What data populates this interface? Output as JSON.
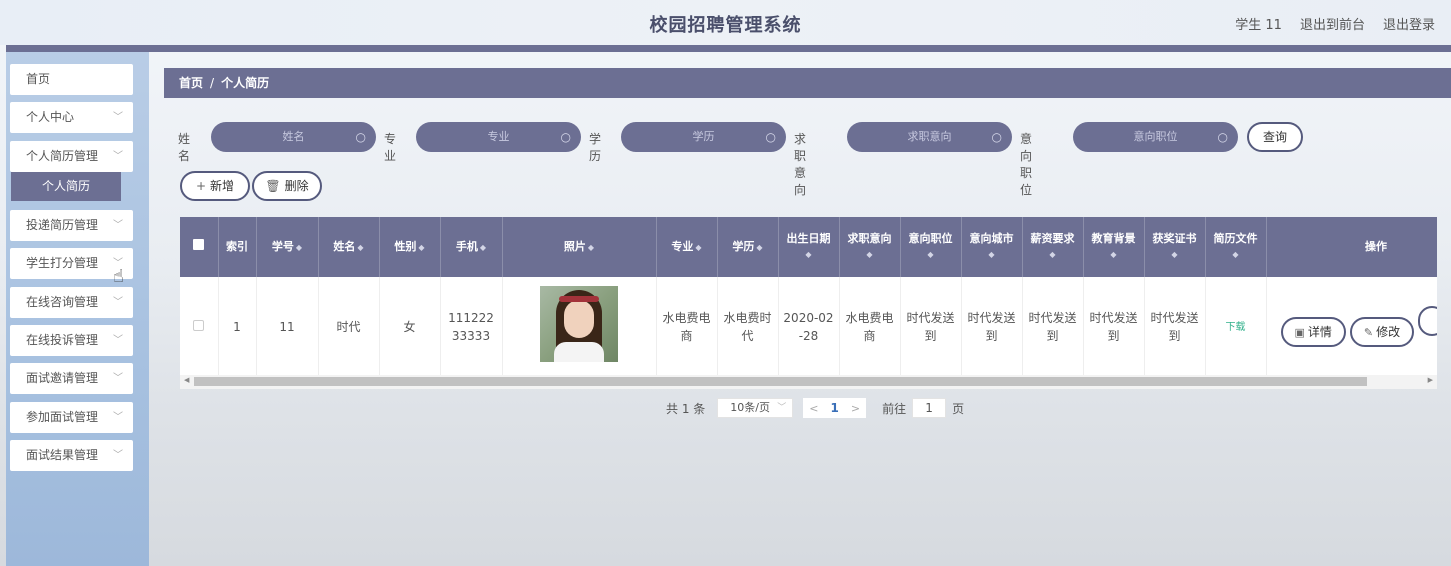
{
  "header": {
    "title": "校园招聘管理系统",
    "user": "学生 11",
    "back_to_front": "退出到前台",
    "logout": "退出登录"
  },
  "sidebar": {
    "items": [
      {
        "label": "首页"
      },
      {
        "label": "个人中心"
      },
      {
        "label": "个人简历管理"
      },
      {
        "label": "个人简历"
      },
      {
        "label": "投递简历管理"
      },
      {
        "label": "学生打分管理"
      },
      {
        "label": "在线咨询管理"
      },
      {
        "label": "在线投诉管理"
      },
      {
        "label": "面试邀请管理"
      },
      {
        "label": "参加面试管理"
      },
      {
        "label": "面试结果管理"
      }
    ]
  },
  "breadcrumb": {
    "home": "首页",
    "sep": "/",
    "current": "个人简历"
  },
  "search": {
    "fields": [
      {
        "label": "姓名",
        "placeholder": "姓名"
      },
      {
        "label": "专业",
        "placeholder": "专业"
      },
      {
        "label": "学历",
        "placeholder": "学历"
      },
      {
        "label": "求职意向",
        "placeholder": "求职意向"
      },
      {
        "label": "意向职位",
        "placeholder": "意向职位"
      }
    ],
    "query_button": "查询"
  },
  "actions": {
    "add": "新增",
    "delete": "删除"
  },
  "table": {
    "headers": [
      "索引",
      "学号",
      "姓名",
      "性别",
      "手机",
      "照片",
      "专业",
      "学历",
      "出生日期",
      "求职意向",
      "意向职位",
      "意向城市",
      "薪资要求",
      "教育背景",
      "获奖证书",
      "简历文件",
      "操作"
    ],
    "rows": [
      {
        "index": "1",
        "student_no": "11",
        "name": "时代",
        "gender": "女",
        "phone": "11122233333",
        "major": "水电费电商",
        "education": "水电费时代",
        "birth": "2020-02-28",
        "intention": "水电费电商",
        "position": "时代发送到",
        "city": "时代发送到",
        "salary": "时代发送到",
        "edu_bg": "时代发送到",
        "awards": "时代发送到",
        "file": "下载",
        "detail_btn": "详情",
        "edit_btn": "修改"
      }
    ]
  },
  "pagination": {
    "total": "共 1 条",
    "page_size": "10条/页",
    "current_page": "1",
    "goto_label": "前往",
    "goto_value": "1",
    "page_unit": "页"
  }
}
